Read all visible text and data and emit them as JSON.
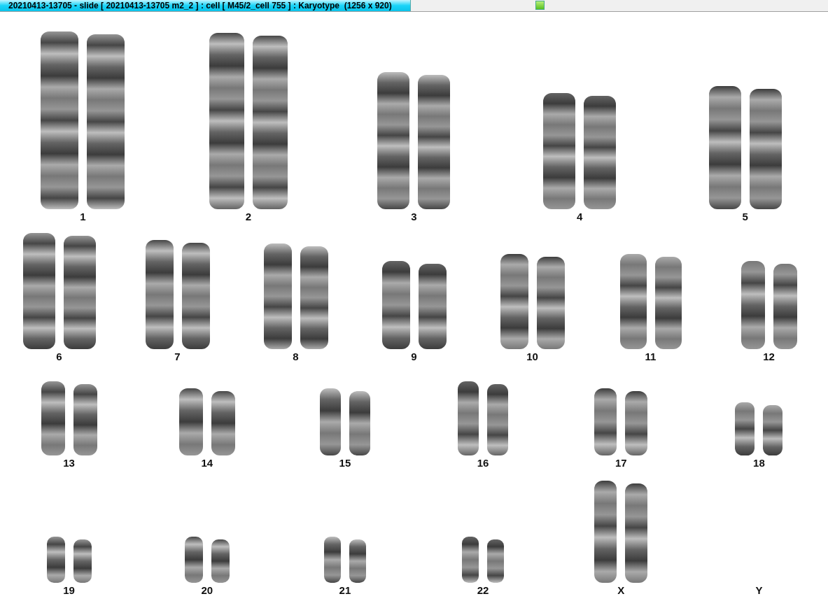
{
  "window": {
    "title": "20210413-13705 - slide [ 20210413-13705 m2_2 ] : cell [ M45/2_cell 755 ] : Karyotype  (1256 x 920)"
  },
  "karyotype_rows": [
    {
      "items": [
        {
          "label": "1",
          "kind": "pair"
        },
        {
          "label": "2",
          "kind": "pair"
        },
        {
          "label": "3",
          "kind": "pair"
        },
        {
          "label": "4",
          "kind": "pair"
        },
        {
          "label": "5",
          "kind": "pair"
        }
      ]
    },
    {
      "items": [
        {
          "label": "6",
          "kind": "pair"
        },
        {
          "label": "7",
          "kind": "pair"
        },
        {
          "label": "8",
          "kind": "pair"
        },
        {
          "label": "9",
          "kind": "pair"
        },
        {
          "label": "10",
          "kind": "pair"
        },
        {
          "label": "11",
          "kind": "pair"
        },
        {
          "label": "12",
          "kind": "pair"
        }
      ]
    },
    {
      "items": [
        {
          "label": "13",
          "kind": "pair"
        },
        {
          "label": "14",
          "kind": "pair"
        },
        {
          "label": "15",
          "kind": "pair"
        },
        {
          "label": "16",
          "kind": "pair"
        },
        {
          "label": "17",
          "kind": "pair"
        },
        {
          "label": "18",
          "kind": "pair"
        }
      ]
    },
    {
      "items": [
        {
          "label": "19",
          "kind": "pair"
        },
        {
          "label": "20",
          "kind": "pair"
        },
        {
          "label": "21",
          "kind": "pair"
        },
        {
          "label": "22",
          "kind": "pair"
        },
        {
          "label": "X",
          "kind": "pair"
        },
        {
          "label": "Y",
          "kind": "empty"
        }
      ]
    }
  ]
}
